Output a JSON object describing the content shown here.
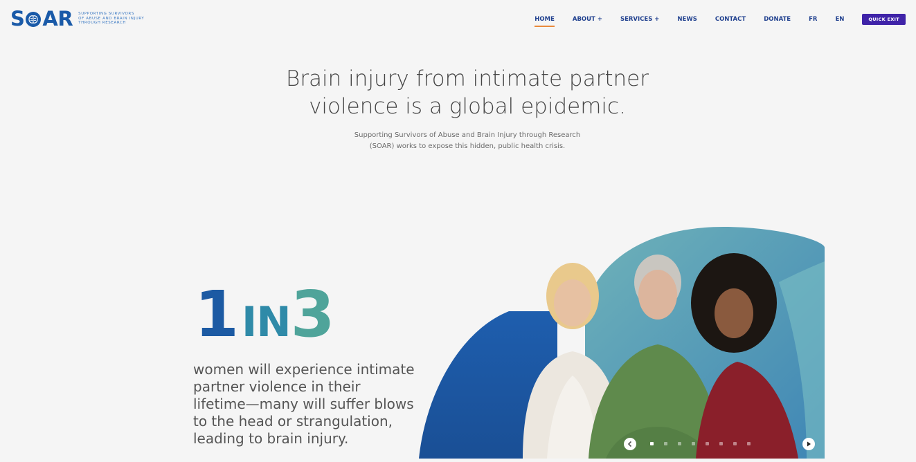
{
  "brand": {
    "name": "SOAR",
    "tagline": [
      "Supporting Survivors",
      "of Abuse and Brain Injury",
      "through Research"
    ]
  },
  "nav": {
    "items": [
      {
        "label": "HOME",
        "active": true
      },
      {
        "label": "ABOUT +"
      },
      {
        "label": "SERVICES +"
      },
      {
        "label": "NEWS"
      },
      {
        "label": "CONTACT"
      },
      {
        "label": "DONATE"
      },
      {
        "label": "FR"
      },
      {
        "label": "EN"
      }
    ],
    "quick_exit_label": "QUICK EXIT"
  },
  "hero": {
    "title_lines": [
      "Brain injury from intimate partner",
      "violence is a global epidemic."
    ],
    "subtitle_lines": [
      "Supporting Survivors of Abuse and Brain Injury through Research",
      "(SOAR) works to expose this hidden, public health crisis."
    ]
  },
  "stat": {
    "one": "1",
    "in": "IN",
    "three": "3",
    "text_lines": [
      "women will experience intimate",
      "partner violence in their",
      "lifetime—many will suffer blows",
      "to the head or strangulation,",
      "leading to brain injury."
    ]
  },
  "slider": {
    "icons": {
      "prev": "chevron-left-icon",
      "next": "play-icon"
    },
    "slide_count": 8,
    "active_slide": 1
  },
  "colors": {
    "brand_blue": "#1a5aa8",
    "nav_text": "#21418f",
    "active_underline": "#e9893b",
    "quick_exit_bg": "#3f23a8",
    "teal": "#4fa49a"
  }
}
